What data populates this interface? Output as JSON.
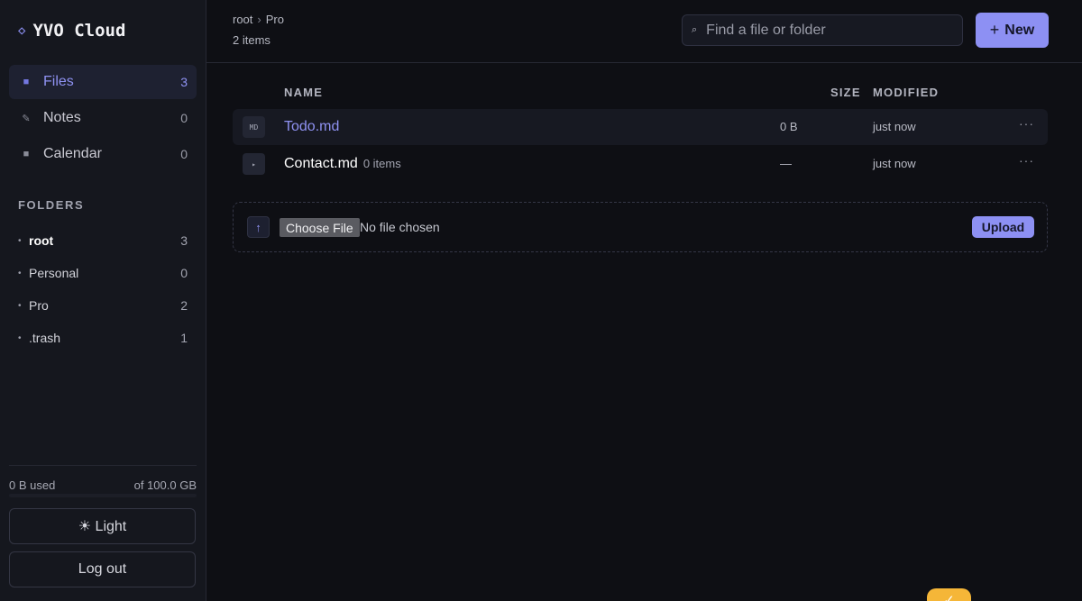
{
  "brand": {
    "logo_glyph": "◇",
    "name": "YVO Cloud"
  },
  "nav": [
    {
      "icon": "square-icon",
      "glyph": "■",
      "label": "Files",
      "count": "3",
      "active": true
    },
    {
      "icon": "pencil-icon",
      "glyph": "✎",
      "label": "Notes",
      "count": "0",
      "active": false
    },
    {
      "icon": "square-icon",
      "glyph": "■",
      "label": "Calendar",
      "count": "0",
      "active": false
    }
  ],
  "folders": {
    "title": "FOLDERS",
    "items": [
      {
        "name": "root",
        "count": "3",
        "current": true
      },
      {
        "name": "Personal",
        "count": "0",
        "current": false
      },
      {
        "name": "Pro",
        "count": "2",
        "current": false
      },
      {
        "name": ".trash",
        "count": "1",
        "current": false
      }
    ]
  },
  "usage": {
    "used": "0 B used",
    "total": "of 100.0 GB"
  },
  "buttons": {
    "theme": "☀ Light",
    "logout": "Log out",
    "new": "New",
    "new_glyph": "+"
  },
  "breadcrumb": {
    "root": "root",
    "sep": "›",
    "current": "Pro"
  },
  "item_count": "2 items",
  "search": {
    "icon_glyph": "⌕",
    "placeholder": "Find a file or folder"
  },
  "table": {
    "headers": {
      "name": "NAME",
      "size": "SIZE",
      "modified": "MODIFIED"
    },
    "rows": [
      {
        "icon_text": "MD",
        "name": "Todo.md",
        "sub": "",
        "size": "0 B",
        "modified": "just now",
        "more": "···"
      },
      {
        "icon_text": "▸",
        "name": "Contact.md",
        "sub": "0 items",
        "size": "—",
        "modified": "just now",
        "more": "···"
      }
    ]
  },
  "upload": {
    "icon_glyph": "↑",
    "choose": "Choose File",
    "status": "No file chosen",
    "button": "Upload"
  },
  "fab": {
    "glyph": "✓"
  },
  "colors": {
    "accent": "#8d90f3",
    "background": "#0e0f14",
    "sidebar": "#15171e",
    "fab": "#f5b638"
  }
}
